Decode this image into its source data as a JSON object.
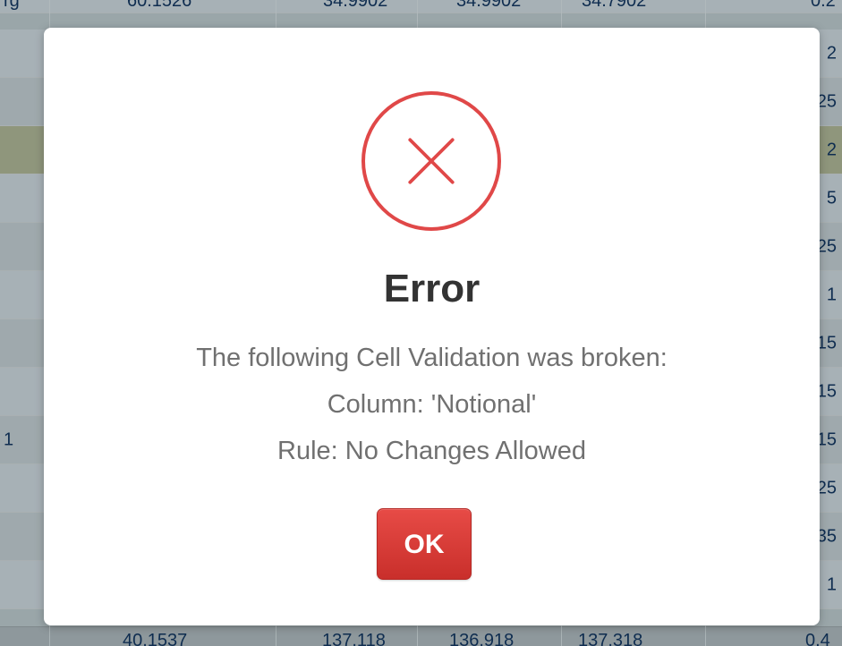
{
  "background_grid": {
    "top_partial_left": "rg",
    "top_partial_values": [
      "60.1526",
      "34.9902",
      "34.9902",
      "34.7902",
      "0.2"
    ],
    "right_column_values": [
      "2",
      "25",
      "2",
      "5",
      "25",
      "1",
      "15",
      "15",
      "15",
      "25",
      "35",
      "1"
    ],
    "left_partial_marker": "1",
    "bottom_values": [
      "40.1537",
      "137.118",
      "136.918",
      "137.318",
      "0.4"
    ]
  },
  "dialog": {
    "icon": "error-x-circle-icon",
    "title": "Error",
    "message_line_1": "The following Cell Validation was broken:",
    "message_line_2": "Column: 'Notional'",
    "message_line_3": "Rule: No Changes Allowed",
    "ok_label": "OK"
  },
  "colors": {
    "error_red": "#e04848",
    "button_red": "#d43f3a",
    "title_text": "#333333",
    "message_text": "#707070",
    "grid_text": "#0f2d50",
    "highlight_row": "#8f967c"
  }
}
